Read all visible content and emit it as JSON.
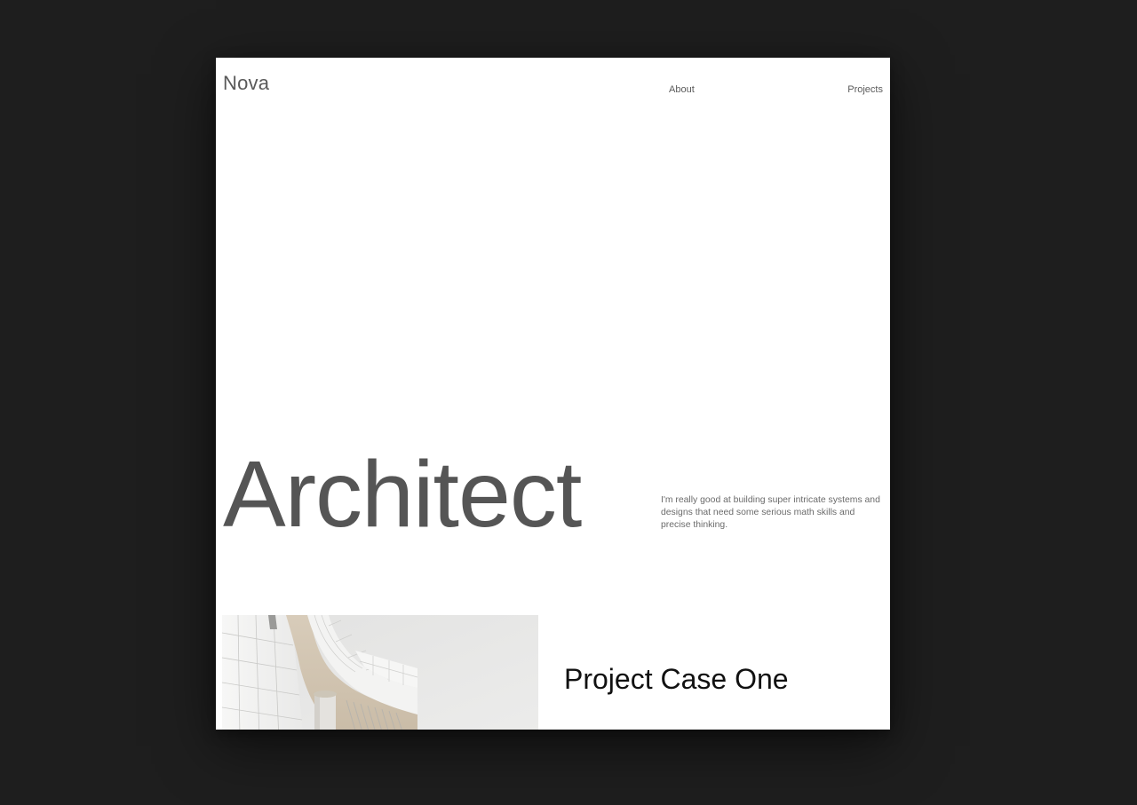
{
  "header": {
    "brand": "Nova",
    "nav": [
      {
        "label": "About"
      },
      {
        "label": "Projects"
      }
    ]
  },
  "hero": {
    "title": "Architect",
    "description": "I'm really good at building super intricate systems and designs that need some serious math skills and precise thinking."
  },
  "projects": [
    {
      "title": "Project Case One",
      "image": "white-curved-building-photo"
    }
  ],
  "colors": {
    "page_background": "#1e1e1e",
    "frame_background": "#ffffff",
    "hero_text": "#555555",
    "project_title": "#111111"
  }
}
